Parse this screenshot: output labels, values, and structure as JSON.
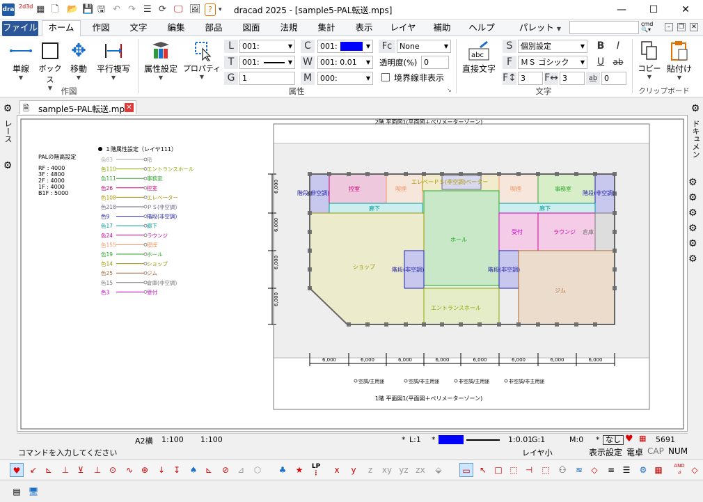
{
  "app": {
    "title": "dracad 2025 - [sample5-PAL転送.mps]",
    "logo": "dra",
    "logo2": "2d3d"
  },
  "menu": {
    "tabs": [
      "ファイル",
      "ホーム",
      "作図",
      "文字",
      "編集",
      "部品",
      "図面",
      "法規",
      "集計",
      "表示",
      "レイヤ",
      "補助",
      "ヘルプ"
    ],
    "palette": "パレット",
    "cmd": "cmd"
  },
  "ribbon": {
    "draw": {
      "label": "作図",
      "buttons": [
        "単線",
        "ボックス",
        "移動",
        "平行複写"
      ]
    },
    "attr": {
      "label": "属性",
      "attr_btn": "属性設定",
      "prop_btn": "プロパティ",
      "L": "001:",
      "T": "001:",
      "G": "1",
      "C": "001:",
      "W": "001: 0.01",
      "M": "000:",
      "Fc": "None",
      "transparency_label": "透明度(%)",
      "transparency": "0",
      "border_hide": "境界線非表示"
    },
    "text": {
      "label": "文字",
      "direct": "直接文字",
      "S": "個別設定",
      "F": "ＭＳ ゴシック",
      "F1": "3",
      "F2": "3",
      "F3": "0",
      "B": "B",
      "I": "I",
      "U": "U",
      "ab": "ab"
    },
    "clip": {
      "label": "クリップボード",
      "copy": "コピー",
      "paste": "貼付け"
    }
  },
  "doc": {
    "tab": "sample5-PAL転送.mps"
  },
  "side": {
    "left": "レース",
    "right": "ドキュメント"
  },
  "drawing": {
    "title2f": "2階 平面図1(平面図＋ペリメーターゾーン)",
    "title1f": "1階 平面図1(平面図＋ペリメーターゾーン)",
    "pal_title": "PALの階高設定",
    "pal_lines": [
      "RF : 4000",
      "3F : 4800",
      "2F : 4000",
      "1F : 4000",
      "B1F : 5000"
    ],
    "attr_title": "１階属性設定（レイヤ111）",
    "legend": [
      {
        "c": "色83",
        "t": "階",
        "col": "#aaaaaa"
      },
      {
        "c": "色110",
        "t": "エントランスホール",
        "col": "#88aa00"
      },
      {
        "c": "色111",
        "t": "事務室",
        "col": "#33aa33"
      },
      {
        "c": "色26",
        "t": "控室",
        "col": "#cc0077"
      },
      {
        "c": "色108",
        "t": "エレベーター",
        "col": "#aa9900"
      },
      {
        "c": "色218",
        "t": "ＰＳ(非空調)",
        "col": "#666688"
      },
      {
        "c": "色9",
        "t": "階段(非空調)",
        "col": "#2222aa"
      },
      {
        "c": "色17",
        "t": "廊下",
        "col": "#009999"
      },
      {
        "c": "色24",
        "t": "ラウンジ",
        "col": "#cc0099"
      },
      {
        "c": "色155",
        "t": "喫煙",
        "col": "#ee9966"
      },
      {
        "c": "色19",
        "t": "ホール",
        "col": "#22aa22"
      },
      {
        "c": "色14",
        "t": "ショップ",
        "col": "#999900"
      },
      {
        "c": "色25",
        "t": "ジム",
        "col": "#aa6633"
      },
      {
        "c": "色15",
        "t": "倉庫(非空調)",
        "col": "#777777"
      },
      {
        "c": "色3",
        "t": "受付",
        "col": "#cc00cc"
      }
    ],
    "rooms": {
      "stair1": "階段(非空調)",
      "hikae": "控室",
      "kitsuen1": "喫煙",
      "ev": "エレベーＰＳ(非空調)ベーター",
      "kitsuen2": "喫煙",
      "jimu": "事務室",
      "stair2": "階段(非空調)",
      "rouka1": "廊下",
      "rouka2": "廊下",
      "hall": "ホール",
      "uketsuke": "受付",
      "lounge": "ラウンジ",
      "souko": "倉庫",
      "shop": "ショップ",
      "stair3": "階段(非空調)",
      "stair4": "階段(非空調)",
      "gym": "ジム",
      "entrance": "エントランスホール"
    },
    "dims_v": [
      "6,000",
      "6,000",
      "6,000",
      "6,000"
    ],
    "dims_h": [
      "6,000",
      "6,000",
      "6,000",
      "6,000",
      "6,000",
      "6,000",
      "6,000",
      "6,000"
    ],
    "usage": [
      "空調/主用途",
      "空調/非主用途",
      "非空調/主用途",
      "非空調/非主用途"
    ]
  },
  "status": {
    "paper": "A2横",
    "scale1": "1:100",
    "scale2": "1:100",
    "layer": "L:1",
    "lw": "1:0.01",
    "group": "G:1",
    "mode": "M:0",
    "none": "なし",
    "count": "5691"
  },
  "cmd": {
    "prompt": "コマンドを入力してください",
    "layer": "レイヤ小",
    "display": "表示設定",
    "calc": "電卓",
    "cap": "CAP",
    "num": "NUM"
  },
  "toolbar": {
    "lp": "LP",
    "x": "x",
    "y": "y",
    "z": "z",
    "xy": "xy",
    "yz": "yz",
    "zx": "zx",
    "and": "AND"
  }
}
